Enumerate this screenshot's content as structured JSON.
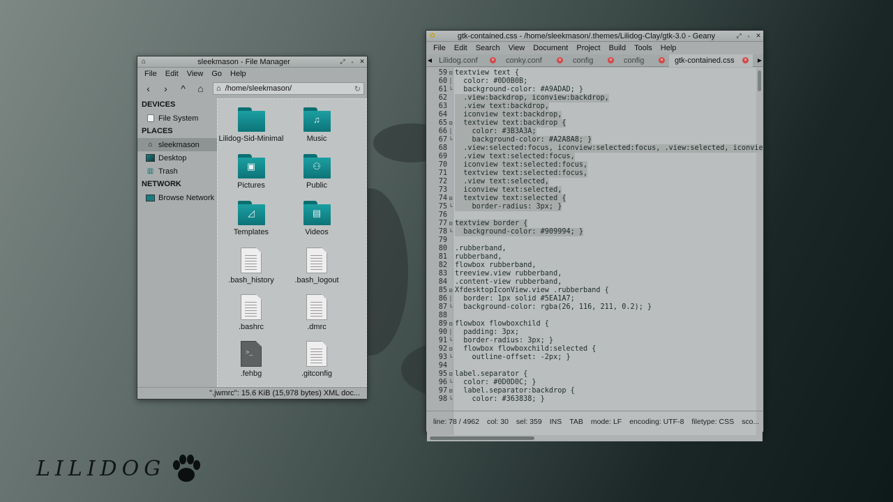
{
  "desktop": {
    "logo_text": "LILIDOG"
  },
  "file_manager": {
    "title": "sleekmason - File Manager",
    "menu": [
      "File",
      "Edit",
      "View",
      "Go",
      "Help"
    ],
    "path": "/home/sleekmason/",
    "sidebar": {
      "devices_header": "DEVICES",
      "devices": [
        {
          "label": "File System",
          "icon": "drive-icon"
        }
      ],
      "places_header": "PLACES",
      "places": [
        {
          "label": "sleekmason",
          "icon": "home-icon"
        },
        {
          "label": "Desktop",
          "icon": "desktop-icon"
        },
        {
          "label": "Trash",
          "icon": "trash-icon"
        }
      ],
      "network_header": "NETWORK",
      "network": [
        {
          "label": "Browse Network",
          "icon": "network-icon"
        }
      ]
    },
    "items": [
      {
        "label": "Lilidog-Sid-Minimal",
        "kind": "folder",
        "symbol": ""
      },
      {
        "label": "Music",
        "kind": "folder",
        "symbol": "♫"
      },
      {
        "label": "Pictures",
        "kind": "folder",
        "symbol": "▣"
      },
      {
        "label": "Public",
        "kind": "folder",
        "symbol": "⚇"
      },
      {
        "label": "Templates",
        "kind": "folder",
        "symbol": "◿"
      },
      {
        "label": "Videos",
        "kind": "folder",
        "symbol": "▤"
      },
      {
        "label": ".bash_history",
        "kind": "file",
        "symbol": ""
      },
      {
        "label": ".bash_logout",
        "kind": "file",
        "symbol": ""
      },
      {
        "label": ".bashrc",
        "kind": "file",
        "symbol": ""
      },
      {
        "label": ".dmrc",
        "kind": "file",
        "symbol": ""
      },
      {
        "label": ".fehbg",
        "kind": "script",
        "symbol": ">_"
      },
      {
        "label": ".gitconfig",
        "kind": "file",
        "symbol": ""
      }
    ],
    "status": "\".jwmrc\": 15.6 KiB (15,978 bytes) XML doc..."
  },
  "geany": {
    "title": "gtk-contained.css - /home/sleekmason/.themes/Lilidog-Clay/gtk-3.0 - Geany",
    "menu": [
      "File",
      "Edit",
      "Search",
      "View",
      "Document",
      "Project",
      "Build",
      "Tools",
      "Help"
    ],
    "tabs": [
      {
        "label": "Lilidog.conf",
        "active": false
      },
      {
        "label": "conky.conf",
        "active": false
      },
      {
        "label": "config",
        "active": false
      },
      {
        "label": "config",
        "active": false
      },
      {
        "label": "gtk-contained.css",
        "active": true
      }
    ],
    "lines": [
      {
        "n": "59",
        "f": "⊟",
        "t": "textview text {",
        "hl": false
      },
      {
        "n": "60",
        "f": "│",
        "t": "  color: #0D0B0B;",
        "hl": false
      },
      {
        "n": "61",
        "f": "└",
        "t": "  background-color: #A9ADAD; }",
        "hl": false
      },
      {
        "n": "62",
        "f": "",
        "t": "  .view:backdrop, iconview:backdrop,",
        "hl": true
      },
      {
        "n": "63",
        "f": "",
        "t": "  .view text:backdrop,",
        "hl": true
      },
      {
        "n": "64",
        "f": "",
        "t": "  iconview text:backdrop,",
        "hl": true
      },
      {
        "n": "65",
        "f": "⊟",
        "t": "  textview text:backdrop {",
        "hl": true
      },
      {
        "n": "66",
        "f": "│",
        "t": "    color: #3B3A3A;",
        "hl": true
      },
      {
        "n": "67",
        "f": "└",
        "t": "    background-color: #A2A8A8; }",
        "hl": true
      },
      {
        "n": "68",
        "f": "",
        "t": "  .view:selected:focus, iconview:selected:focus, .view:selected, iconview",
        "hl": true
      },
      {
        "n": "69",
        "f": "",
        "t": "  .view text:selected:focus,",
        "hl": true
      },
      {
        "n": "70",
        "f": "",
        "t": "  iconview text:selected:focus,",
        "hl": true
      },
      {
        "n": "71",
        "f": "",
        "t": "  textview text:selected:focus,",
        "hl": true
      },
      {
        "n": "72",
        "f": "",
        "t": "  .view text:selected,",
        "hl": true
      },
      {
        "n": "73",
        "f": "",
        "t": "  iconview text:selected,",
        "hl": true
      },
      {
        "n": "74",
        "f": "⊟",
        "t": "  textview text:selected {",
        "hl": true
      },
      {
        "n": "75",
        "f": "└",
        "t": "    border-radius: 3px; }",
        "hl": true
      },
      {
        "n": "76",
        "f": "",
        "t": "",
        "hl": false
      },
      {
        "n": "77",
        "f": "⊟",
        "t": "textview border {",
        "hl": true
      },
      {
        "n": "78",
        "f": "└",
        "t": "  background-color: #909994; }",
        "hl": true
      },
      {
        "n": "79",
        "f": "",
        "t": "",
        "hl": false
      },
      {
        "n": "80",
        "f": "",
        "t": ".rubberband,",
        "hl": false
      },
      {
        "n": "81",
        "f": "",
        "t": "rubberband,",
        "hl": false
      },
      {
        "n": "82",
        "f": "",
        "t": "flowbox rubberband,",
        "hl": false
      },
      {
        "n": "83",
        "f": "",
        "t": "treeview.view rubberband,",
        "hl": false
      },
      {
        "n": "84",
        "f": "",
        "t": ".content-view rubberband,",
        "hl": false
      },
      {
        "n": "85",
        "f": "⊟",
        "t": "XfdesktopIconView.view .rubberband {",
        "hl": false
      },
      {
        "n": "86",
        "f": "│",
        "t": "  border: 1px solid #5EA1A7;",
        "hl": false
      },
      {
        "n": "87",
        "f": "└",
        "t": "  background-color: rgba(26, 116, 211, 0.2); }",
        "hl": false
      },
      {
        "n": "88",
        "f": "",
        "t": "",
        "hl": false
      },
      {
        "n": "89",
        "f": "⊟",
        "t": "flowbox flowboxchild {",
        "hl": false
      },
      {
        "n": "90",
        "f": "│",
        "t": "  padding: 3px;",
        "hl": false
      },
      {
        "n": "91",
        "f": "└",
        "t": "  border-radius: 3px; }",
        "hl": false
      },
      {
        "n": "92",
        "f": "⊟",
        "t": "  flowbox flowboxchild:selected {",
        "hl": false
      },
      {
        "n": "93",
        "f": "└",
        "t": "    outline-offset: -2px; }",
        "hl": false
      },
      {
        "n": "94",
        "f": "",
        "t": "",
        "hl": false
      },
      {
        "n": "95",
        "f": "⊟",
        "t": "label.separator {",
        "hl": false
      },
      {
        "n": "96",
        "f": "└",
        "t": "  color: #0D0D0C; }",
        "hl": false
      },
      {
        "n": "97",
        "f": "⊟",
        "t": "  label.separator:backdrop {",
        "hl": false
      },
      {
        "n": "98",
        "f": "└",
        "t": "    color: #363838; }",
        "hl": false
      }
    ],
    "status": [
      "line: 78 / 4962",
      "col: 30",
      "sel: 359",
      "INS",
      "TAB",
      "mode: LF",
      "encoding: UTF-8",
      "filetype: CSS",
      "sco..."
    ]
  }
}
